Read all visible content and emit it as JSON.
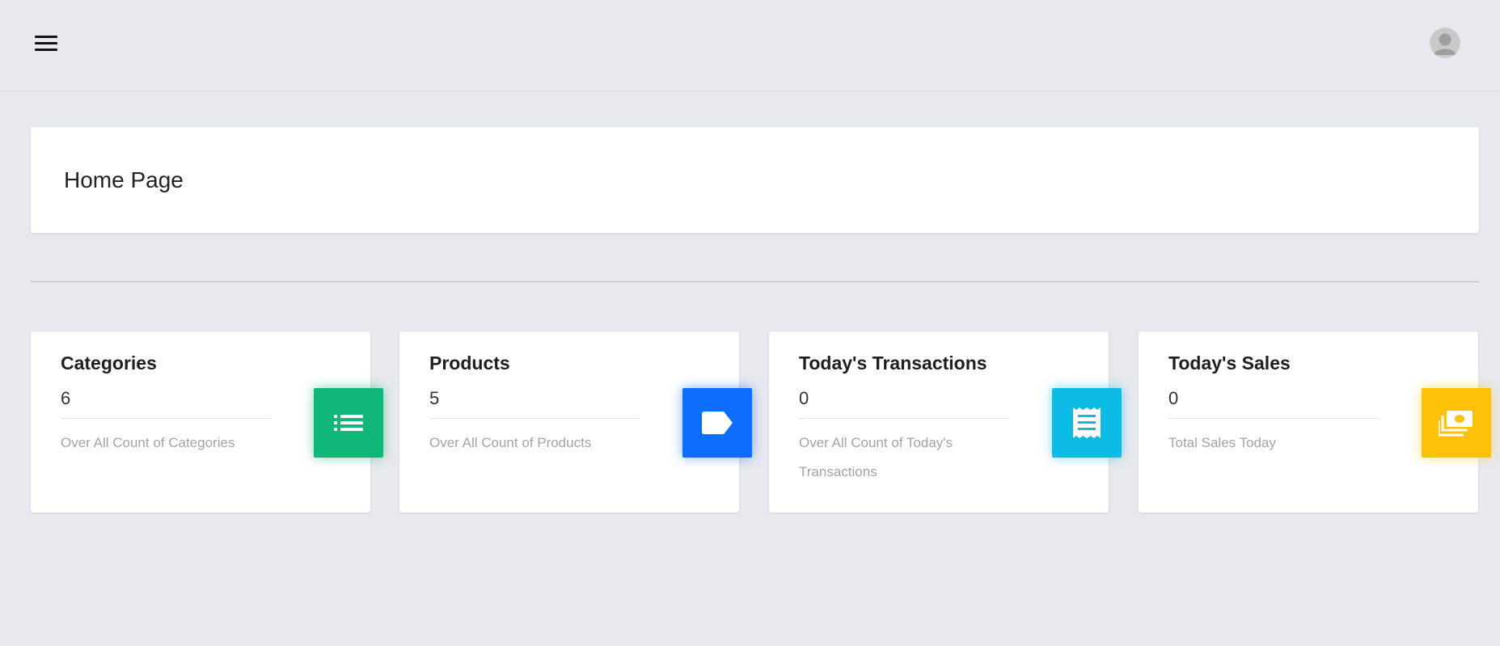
{
  "header": {
    "menu_icon": "hamburger-menu-icon",
    "avatar_icon": "user-avatar-icon"
  },
  "page": {
    "title": "Home Page"
  },
  "cards": [
    {
      "title": "Categories",
      "value": "6",
      "description": "Over All Count of Categories",
      "icon": "list-icon",
      "color": "#0fb878"
    },
    {
      "title": "Products",
      "value": "5",
      "description": "Over All Count of Products",
      "icon": "tag-icon",
      "color": "#0d6efd"
    },
    {
      "title": "Today's Transactions",
      "value": "0",
      "description": "Over All Count of Today's Transactions",
      "icon": "receipt-icon",
      "color": "#0dbce4"
    },
    {
      "title": "Today's Sales",
      "value": "0",
      "description": "Total Sales Today",
      "icon": "money-bills-icon",
      "color": "#ffc107"
    }
  ]
}
